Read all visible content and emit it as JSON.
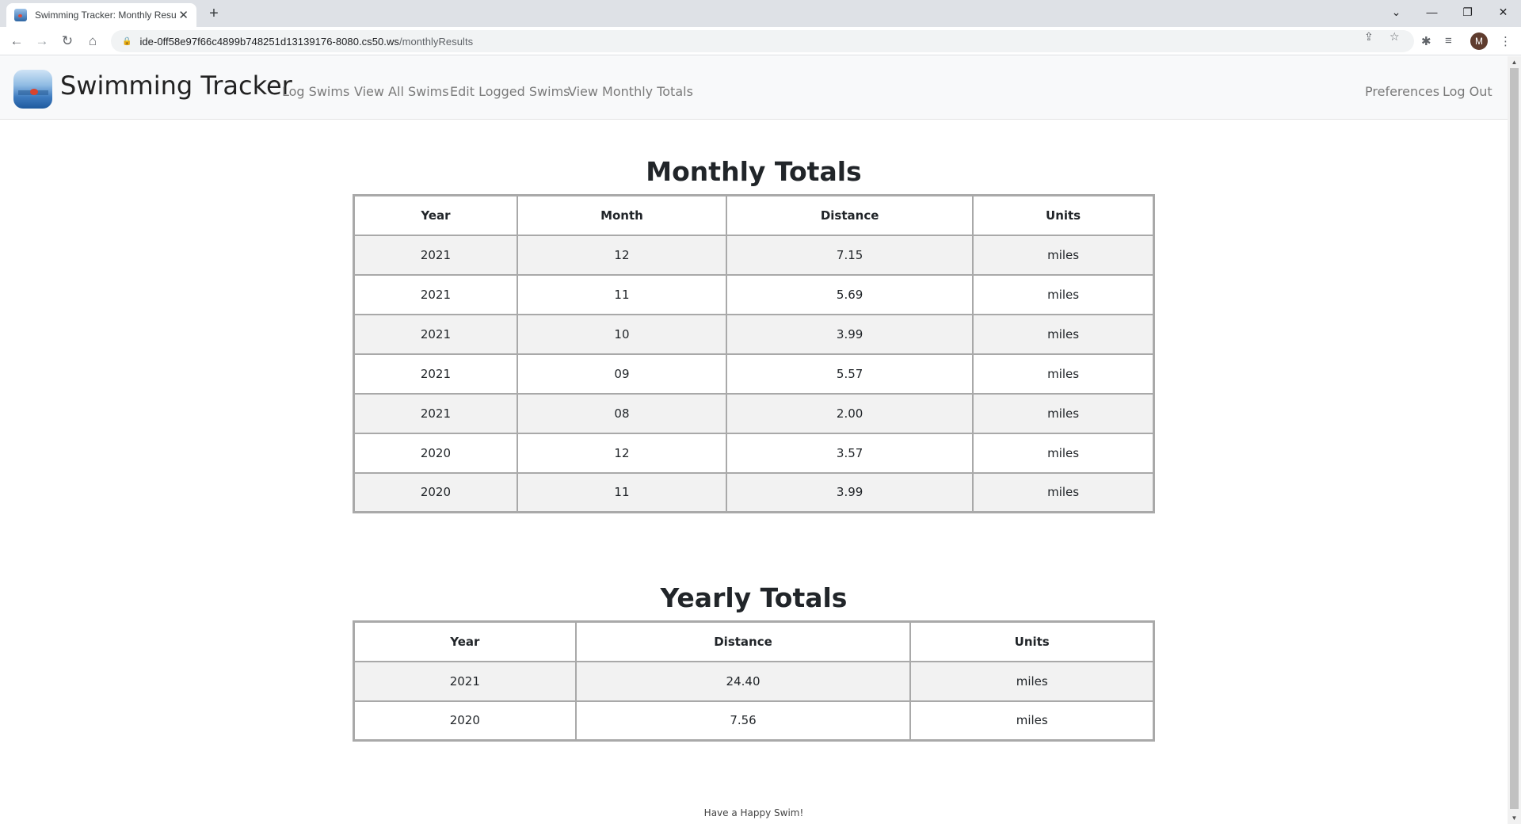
{
  "browser": {
    "tab_title": "Swimming Tracker: Monthly Resu",
    "url_host": "ide-0ff58e97f66c4899b748251d13139176-8080.cs50.ws",
    "url_path": "/monthlyResults",
    "avatar_letter": "M"
  },
  "navbar": {
    "brand": "Swimming Tracker",
    "links": [
      "Log Swims",
      "View All Swims",
      "Edit Logged Swims",
      "View Monthly Totals"
    ],
    "right_links": [
      "Preferences",
      "Log Out"
    ]
  },
  "monthly": {
    "title": "Monthly Totals",
    "headers": [
      "Year",
      "Month",
      "Distance",
      "Units"
    ],
    "rows": [
      [
        "2021",
        "12",
        "7.15",
        "miles"
      ],
      [
        "2021",
        "11",
        "5.69",
        "miles"
      ],
      [
        "2021",
        "10",
        "3.99",
        "miles"
      ],
      [
        "2021",
        "09",
        "5.57",
        "miles"
      ],
      [
        "2021",
        "08",
        "2.00",
        "miles"
      ],
      [
        "2020",
        "12",
        "3.57",
        "miles"
      ],
      [
        "2020",
        "11",
        "3.99",
        "miles"
      ]
    ]
  },
  "yearly": {
    "title": "Yearly Totals",
    "headers": [
      "Year",
      "Distance",
      "Units"
    ],
    "rows": [
      [
        "2021",
        "24.40",
        "miles"
      ],
      [
        "2020",
        "7.56",
        "miles"
      ]
    ]
  },
  "footer": {
    "text": "Have a Happy Swim!"
  }
}
